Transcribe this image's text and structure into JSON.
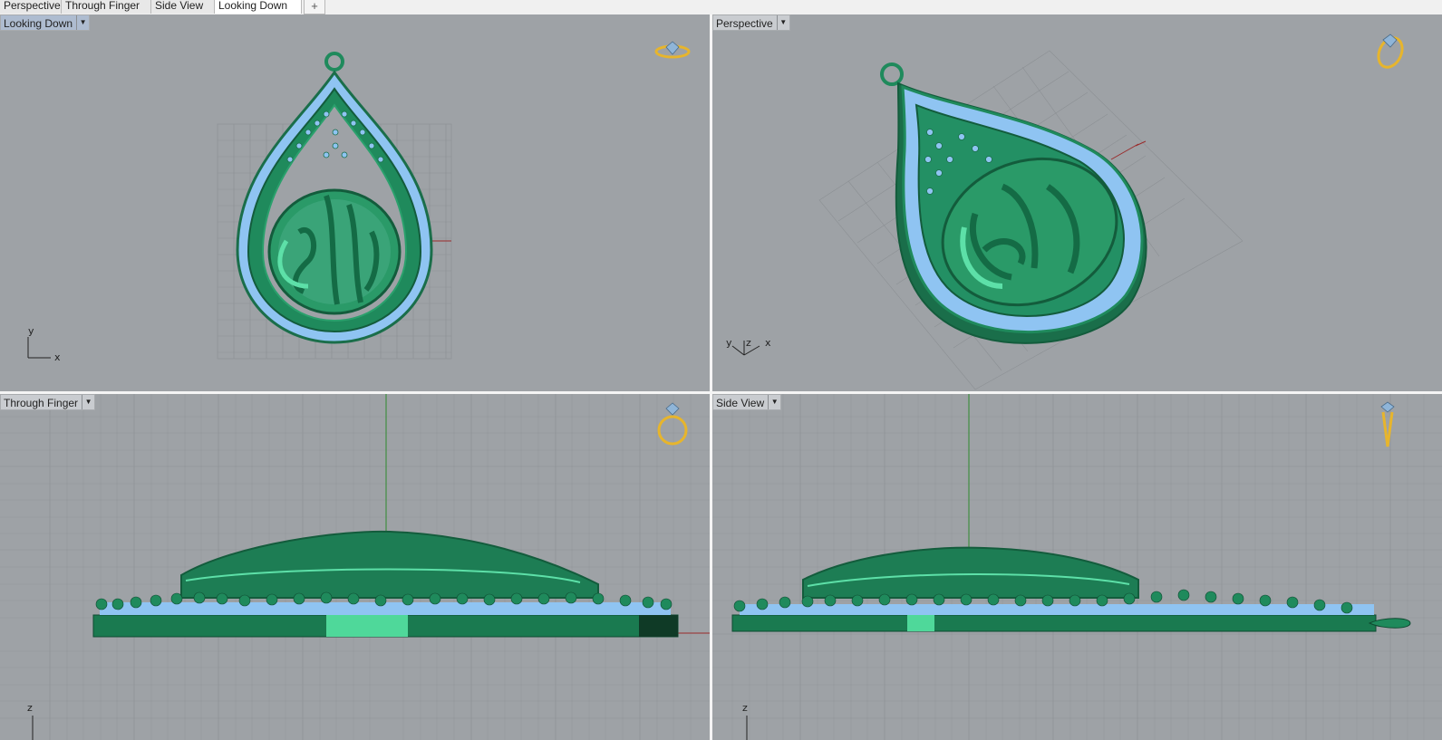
{
  "tabs": [
    {
      "label": "Perspective",
      "active": false
    },
    {
      "label": "Through Finger",
      "active": false
    },
    {
      "label": "Side View",
      "active": false
    },
    {
      "label": "Looking Down",
      "active": true
    }
  ],
  "add_tab_icon": "plus-icon",
  "viewports": {
    "top_left": {
      "label": "Looking Down",
      "active": true,
      "axes": [
        "y",
        "x"
      ],
      "ring_icon": "ring-top-icon"
    },
    "top_right": {
      "label": "Perspective",
      "active": false,
      "axes": [
        "y",
        "z",
        "x"
      ],
      "ring_icon": "ring-perspective-icon"
    },
    "bottom_left": {
      "label": "Through Finger",
      "active": false,
      "axes": [
        "z"
      ],
      "ring_icon": "ring-front-icon"
    },
    "bottom_right": {
      "label": "Side View",
      "active": false,
      "axes": [
        "z"
      ],
      "ring_icon": "ring-side-icon"
    }
  },
  "colors": {
    "viewport_bg": "#9ea2a6",
    "metal": "#1f8a5c",
    "metal_highlight": "#5de0a8",
    "gems": "#8fc4f2",
    "ring_icon": "#e7b52c",
    "grid": "#8c9094",
    "axis_red": "#9a2b2b",
    "axis_green": "#2f8a2f"
  }
}
